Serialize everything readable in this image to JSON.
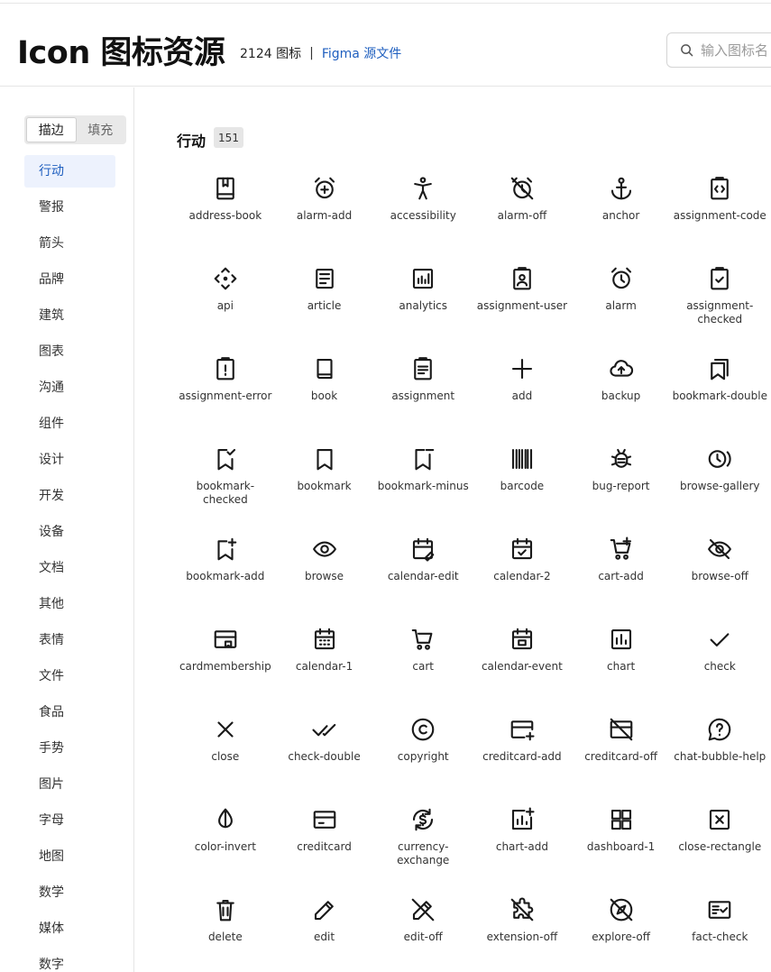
{
  "header": {
    "title": "Icon 图标资源",
    "count": "2124 图标",
    "separator": "|",
    "figma_link": "Figma 源文件",
    "search_placeholder": "输入图标名"
  },
  "sidebar": {
    "toggle": [
      {
        "label": "描边",
        "active": true
      },
      {
        "label": "填充",
        "active": false
      }
    ],
    "categories": [
      "行动",
      "警报",
      "箭头",
      "品牌",
      "建筑",
      "图表",
      "沟通",
      "组件",
      "设计",
      "开发",
      "设备",
      "文档",
      "其他",
      "表情",
      "文件",
      "食品",
      "手势",
      "图片",
      "字母",
      "地图",
      "数学",
      "媒体",
      "数字"
    ],
    "active_index": 0
  },
  "section": {
    "title": "行动",
    "count": "151"
  },
  "icons": [
    "address-book",
    "alarm-add",
    "accessibility",
    "alarm-off",
    "anchor",
    "assignment-code",
    "api",
    "article",
    "analytics",
    "assignment-user",
    "alarm",
    "assignment-checked",
    "assignment-error",
    "book",
    "assignment",
    "add",
    "backup",
    "bookmark-double",
    "bookmark-checked",
    "bookmark",
    "bookmark-minus",
    "barcode",
    "bug-report",
    "browse-gallery",
    "bookmark-add",
    "browse",
    "calendar-edit",
    "calendar-2",
    "cart-add",
    "browse-off",
    "cardmembership",
    "calendar-1",
    "cart",
    "calendar-event",
    "chart",
    "check",
    "close",
    "check-double",
    "copyright",
    "creditcard-add",
    "creditcard-off",
    "chat-bubble-help",
    "color-invert",
    "creditcard",
    "currency-exchange",
    "chart-add",
    "dashboard-1",
    "close-rectangle",
    "delete",
    "edit",
    "edit-off",
    "extension-off",
    "explore-off",
    "fact-check"
  ],
  "icon_color": "#1a1a1a",
  "accent_color": "#1f5fbf"
}
